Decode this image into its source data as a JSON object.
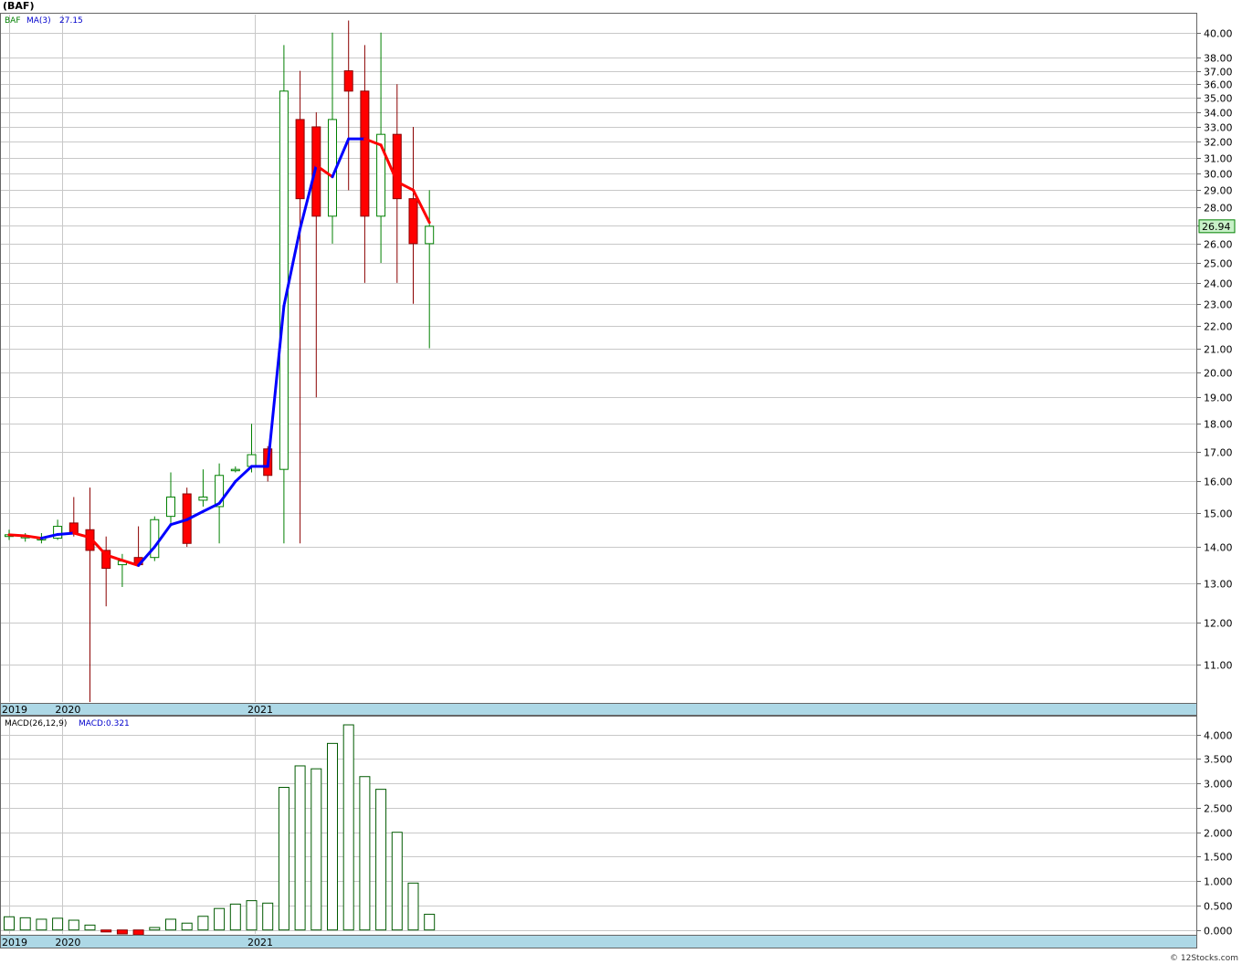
{
  "title": "(BAF)",
  "watermark": "© 12Stocks.com",
  "legend": {
    "symbol": "BAF",
    "ma_label": "MA(3)",
    "ma_value": "27.15",
    "macd_label": "MACD(26,12,9)",
    "macd_value": "MACD:0.321"
  },
  "last_price": "26.94",
  "colors": {
    "up": "#008000",
    "down": "#ff0000",
    "ma_rising": "#0000ff",
    "ma_falling": "#ff0000",
    "date_band": "#add8e6",
    "grid": "#c8c8c8",
    "price_tag": "#c8f0c8"
  },
  "chart_data": [
    {
      "type": "candlestick",
      "scale": "log",
      "ylim": [
        10.2,
        41.5
      ],
      "y_ticks": [
        "11.00",
        "12.00",
        "13.00",
        "14.00",
        "15.00",
        "16.00",
        "17.00",
        "18.00",
        "19.00",
        "20.00",
        "21.00",
        "22.00",
        "23.00",
        "24.00",
        "25.00",
        "26.00",
        "27.00",
        "28.00",
        "29.00",
        "30.00",
        "31.00",
        "32.00",
        "33.00",
        "34.00",
        "35.00",
        "36.00",
        "37.00",
        "38.00",
        "40.00"
      ],
      "x_labels": [
        {
          "label": "2019",
          "index": 0
        },
        {
          "label": "2020",
          "index": 3.3
        },
        {
          "label": "2021",
          "index": 15.2
        }
      ],
      "candles": [
        {
          "o": 14.3,
          "h": 14.5,
          "l": 14.2,
          "c": 14.35
        },
        {
          "o": 14.3,
          "h": 14.4,
          "l": 14.15,
          "c": 14.3
        },
        {
          "o": 14.2,
          "h": 14.4,
          "l": 14.1,
          "c": 14.25
        },
        {
          "o": 14.25,
          "h": 14.8,
          "l": 14.2,
          "c": 14.6
        },
        {
          "o": 14.7,
          "h": 15.5,
          "l": 14.3,
          "c": 14.4
        },
        {
          "o": 14.5,
          "h": 15.8,
          "l": 10.2,
          "c": 13.9
        },
        {
          "o": 13.9,
          "h": 14.3,
          "l": 12.4,
          "c": 13.4
        },
        {
          "o": 13.5,
          "h": 13.8,
          "l": 12.9,
          "c": 13.6
        },
        {
          "o": 13.7,
          "h": 14.6,
          "l": 13.5,
          "c": 13.5
        },
        {
          "o": 13.7,
          "h": 14.9,
          "l": 13.6,
          "c": 14.8
        },
        {
          "o": 14.9,
          "h": 16.3,
          "l": 14.7,
          "c": 15.5
        },
        {
          "o": 15.6,
          "h": 15.8,
          "l": 14.0,
          "c": 14.1
        },
        {
          "o": 15.4,
          "h": 16.4,
          "l": 15.2,
          "c": 15.5
        },
        {
          "o": 15.2,
          "h": 16.6,
          "l": 14.1,
          "c": 16.2
        },
        {
          "o": 16.4,
          "h": 16.5,
          "l": 16.3,
          "c": 16.4
        },
        {
          "o": 16.5,
          "h": 18.0,
          "l": 16.3,
          "c": 16.9
        },
        {
          "o": 17.1,
          "h": 17.2,
          "l": 16.0,
          "c": 16.2
        },
        {
          "o": 16.4,
          "h": 39.0,
          "l": 14.1,
          "c": 35.5
        },
        {
          "o": 33.5,
          "h": 37.0,
          "l": 14.1,
          "c": 28.5
        },
        {
          "o": 33.0,
          "h": 34.0,
          "l": 19.0,
          "c": 27.5
        },
        {
          "o": 27.5,
          "h": 40.0,
          "l": 26.0,
          "c": 33.5
        },
        {
          "o": 37.0,
          "h": 41.0,
          "l": 29.0,
          "c": 35.5
        },
        {
          "o": 35.5,
          "h": 39.0,
          "l": 24.0,
          "c": 27.5
        },
        {
          "o": 27.5,
          "h": 40.0,
          "l": 25.0,
          "c": 32.5
        },
        {
          "o": 32.5,
          "h": 36.0,
          "l": 24.0,
          "c": 28.5
        },
        {
          "o": 28.5,
          "h": 33.0,
          "l": 23.0,
          "c": 26.0
        },
        {
          "o": 26.0,
          "h": 29.0,
          "l": 21.0,
          "c": 26.94
        }
      ],
      "ma3": [
        14.35,
        14.32,
        14.25,
        14.36,
        14.4,
        14.27,
        13.77,
        13.62,
        13.48,
        14.0,
        14.65,
        14.8,
        15.05,
        15.3,
        16.0,
        16.5,
        16.5,
        22.9,
        26.8,
        30.5,
        29.8,
        32.2,
        32.2,
        31.8,
        29.5,
        29.0,
        27.15
      ]
    },
    {
      "type": "bar",
      "name": "MACD(26,12,9)",
      "ylim": [
        -0.08,
        4.35
      ],
      "y_ticks": [
        "0.000",
        "0.500",
        "1.000",
        "1.500",
        "2.000",
        "2.500",
        "3.000",
        "3.500",
        "4.000"
      ],
      "x_labels": [
        {
          "label": "2019",
          "index": 0
        },
        {
          "label": "2020",
          "index": 3.3
        },
        {
          "label": "2021",
          "index": 15.2
        }
      ],
      "values": [
        0.27,
        0.25,
        0.22,
        0.24,
        0.2,
        0.1,
        -0.04,
        -0.08,
        -0.1,
        0.05,
        0.22,
        0.14,
        0.28,
        0.44,
        0.53,
        0.6,
        0.55,
        2.92,
        3.36,
        3.3,
        3.82,
        4.2,
        3.14,
        2.88,
        2.0,
        0.96,
        0.321
      ]
    }
  ]
}
